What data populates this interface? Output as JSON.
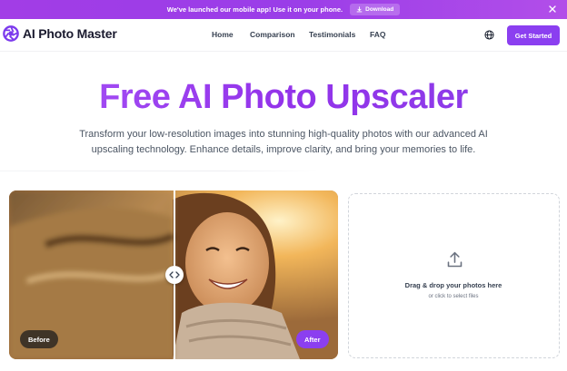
{
  "announcement": {
    "text": "We've launched our mobile app! Use it on your phone.",
    "button_label": "Download",
    "close_icon": "close-icon"
  },
  "nav": {
    "brand": "AI Photo Master",
    "links": [
      "Home",
      "Comparison",
      "Testimonials",
      "FAQ"
    ],
    "language_icon": "globe-icon",
    "cta_label": "Get Started"
  },
  "hero": {
    "title": "Free AI Photo Upscaler",
    "subtitle": "Transform your low-resolution images into stunning high-quality photos with our advanced AI upscaling technology. Enhance details, improve clarity, and bring your memories to life."
  },
  "comparison": {
    "before_label": "Before",
    "after_label": "After",
    "split_position": 0.5,
    "handle_icon": "left-right-arrows-icon"
  },
  "upload": {
    "icon": "upload-icon",
    "title": "Drag & drop your photos here",
    "subtitle": "or click to select files"
  },
  "colors": {
    "brand": "#8b3ff0",
    "announcement": "#a23de6",
    "title_gradient_start": "#a855f7",
    "title_gradient_end": "#8b3fe8"
  }
}
